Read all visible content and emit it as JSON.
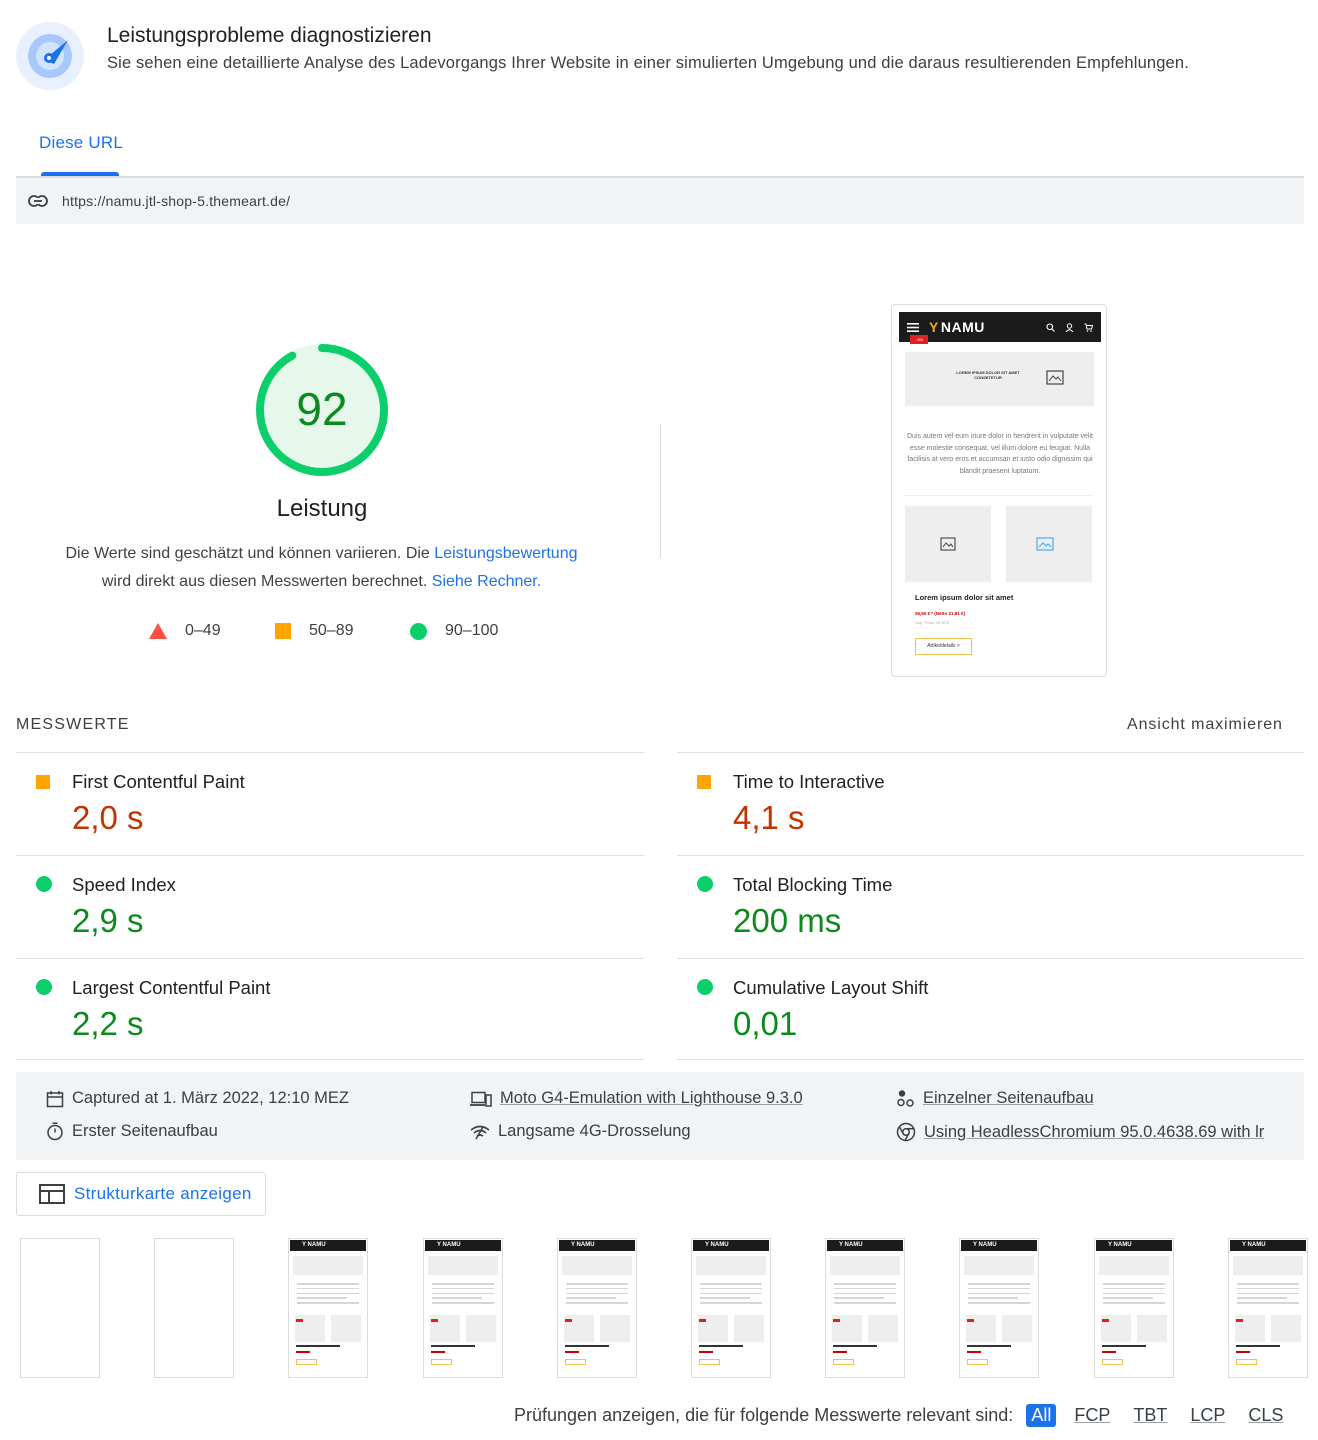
{
  "header": {
    "title": "Leistungsprobleme diagnostizieren",
    "subtitle": "Sie sehen eine detaillierte Analyse des Ladevorgangs Ihrer Website in einer simulierten Umgebung und die daraus resultierenden Empfehlungen."
  },
  "tabs": [
    {
      "label": "Diese URL",
      "active": true
    }
  ],
  "url": "https://namu.jtl-shop-5.themeart.de/",
  "score": {
    "value": "92",
    "fraction": 0.92,
    "label": "Leistung",
    "desc_1": "Die Werte sind geschätzt und können variieren. Die ",
    "link_1": "Leistungsbewertung",
    "desc_2": " wird direkt aus diesen Messwerten berechnet. ",
    "link_2": "Siehe Rechner."
  },
  "legend": [
    {
      "range": "0–49",
      "color": "#ff4e42",
      "shape": "triangle"
    },
    {
      "range": "50–89",
      "color": "#ffa400",
      "shape": "square"
    },
    {
      "range": "90–100",
      "color": "#0cce6b",
      "shape": "circle"
    }
  ],
  "screenshot": {
    "logo": "NAMU",
    "hero_text": "LOREM IPSUM DOLOR SIT AMET CONSETETUR",
    "body_text": "Duis autem vel eum iriure dolor in hendrerit in vulputate velit esse molestie consequat, vel illum dolore eu feugiat. Nulla facilisis at vero eros et accumsan et iusto odio dignissim qui blandit praesent luptatum.",
    "badge": "- 8%",
    "product_title": "Lorem ipsum dolor sit amet",
    "price": "26,90 € * (Netto 21,81 €)",
    "old_price": "Uvp: Preis: 29,90 €",
    "button": "Artikeldetails >"
  },
  "metrics": {
    "title": "MESSWERTE",
    "expand": "Ansicht maximieren",
    "items": [
      {
        "name": "First Contentful Paint",
        "value": "2,0 s",
        "rating": "average"
      },
      {
        "name": "Time to Interactive",
        "value": "4,1 s",
        "rating": "average"
      },
      {
        "name": "Speed Index",
        "value": "2,9 s",
        "rating": "pass"
      },
      {
        "name": "Total Blocking Time",
        "value": "200 ms",
        "rating": "pass"
      },
      {
        "name": "Largest Contentful Paint",
        "value": "2,2 s",
        "rating": "pass"
      },
      {
        "name": "Cumulative Layout Shift",
        "value": "0,01",
        "rating": "pass"
      }
    ]
  },
  "info": {
    "captured": "Captured at 1. März 2022, 12:10 MEZ",
    "first_load": "Erster Seitenaufbau",
    "emulation": "Moto G4-Emulation with Lighthouse 9.3.0",
    "throttling": "Langsame 4G-Drosselung",
    "single_load": "Einzelner Seitenaufbau",
    "browser": "Using HeadlessChromium 95.0.4638.69 with lr"
  },
  "treemap_button": "Strukturkarte anzeigen",
  "filmstrip": {
    "frames": 10,
    "blank_frames": 2
  },
  "filter": {
    "label": "Prüfungen anzeigen, die für folgende Messwerte relevant sind:",
    "chips": [
      "All",
      "FCP",
      "TBT",
      "LCP",
      "CLS"
    ],
    "active": "All"
  }
}
